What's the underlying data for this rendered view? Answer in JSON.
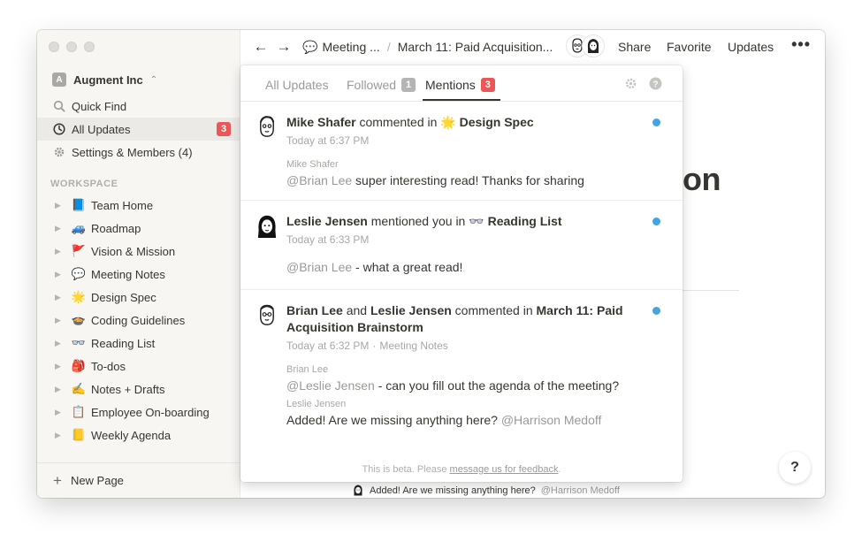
{
  "sidebar": {
    "workspace": {
      "initial": "A",
      "name": "Augment Inc"
    },
    "nav": {
      "quick_find": "Quick Find",
      "all_updates": "All Updates",
      "all_updates_count": "3",
      "settings": "Settings & Members (4)"
    },
    "section_label": "WORKSPACE",
    "pages": [
      {
        "emoji": "📘",
        "label": "Team Home"
      },
      {
        "emoji": "🚙",
        "label": "Roadmap"
      },
      {
        "emoji": "🚩",
        "label": "Vision & Mission"
      },
      {
        "emoji": "💬",
        "label": "Meeting Notes"
      },
      {
        "emoji": "🌟",
        "label": "Design Spec"
      },
      {
        "emoji": "🍲",
        "label": "Coding Guidelines"
      },
      {
        "emoji": "👓",
        "label": "Reading List"
      },
      {
        "emoji": "🎒",
        "label": "To-dos"
      },
      {
        "emoji": "✍️",
        "label": "Notes + Drafts"
      },
      {
        "emoji": "📋",
        "label": "Employee On-boarding"
      },
      {
        "emoji": "📒",
        "label": "Weekly Agenda"
      }
    ],
    "new_page": "New Page"
  },
  "topbar": {
    "back_icon": "←",
    "forward_icon": "→",
    "crumb1_icon": "💬",
    "crumb1": "Meeting ...",
    "crumb_sep": "/",
    "crumb2": "March 11: Paid Acquisition...",
    "share": "Share",
    "favorite": "Favorite",
    "updates": "Updates",
    "more": "•••"
  },
  "background": {
    "heading_fragment": "on",
    "bottom_comment": "Added! Are we missing anything here?",
    "bottom_comment_mention": "@Harrison Medoff",
    "help": "?"
  },
  "popover": {
    "tabs": {
      "all_updates": "All Updates",
      "followed": "Followed",
      "followed_count": "1",
      "mentions": "Mentions",
      "mentions_count": "3"
    },
    "notifications": [
      {
        "actor": "Mike Shafer",
        "verb": "commented in",
        "target_emoji": "🌟",
        "target": "Design Spec",
        "time": "Today at 6:37 PM",
        "author": "Mike Shafer",
        "mention": "@Brian Lee",
        "message": "super interesting read! Thanks for sharing"
      },
      {
        "actor": "Leslie Jensen",
        "verb": "mentioned you in",
        "target_emoji": "👓",
        "target": "Reading List",
        "time": "Today at 6:33 PM",
        "mention": "@Brian Lee",
        "message": "- what a great read!"
      },
      {
        "actor": "Brian Lee",
        "conj": "and",
        "actor2": "Leslie Jensen",
        "verb": "commented in",
        "target": "March 11: Paid Acquisition Brainstorm",
        "time": "Today at 6:32 PM",
        "dot_sep": "·",
        "location": "Meeting Notes",
        "author1": "Brian Lee",
        "mention1": "@Leslie Jensen",
        "message1": "- can you fill out the agenda of the meeting?",
        "author2": "Leslie Jensen",
        "message2": "Added! Are we missing anything here?",
        "mention2": "@Harrison Medoff"
      }
    ],
    "footer_text": "This is beta. Please",
    "footer_link": "message us for feedback",
    "footer_end": "."
  },
  "colors": {
    "unread_dot": "#45a3e0",
    "badge_red": "#eb5757",
    "badge_gray": "#b5b4b2"
  }
}
